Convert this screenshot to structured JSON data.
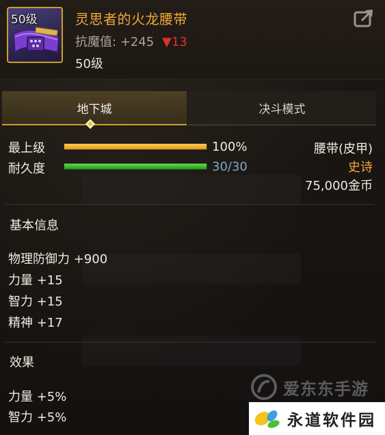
{
  "item": {
    "level_badge": "50级",
    "name": "灵思者的火龙腰带",
    "stat_label": "抗魔值:",
    "stat_value": "+245",
    "stat_change": "▼13",
    "required_level": "50级"
  },
  "tabs": [
    {
      "label": "地下城",
      "active": true
    },
    {
      "label": "决斗模式",
      "active": false
    }
  ],
  "bars": [
    {
      "label": "最上级",
      "value_text": "100%",
      "fill": 1.0,
      "color": "#f0a020"
    },
    {
      "label": "耐久度",
      "value_text": "30/30",
      "fill": 1.0,
      "color": "#3cc030"
    }
  ],
  "info": {
    "type": "腰带(皮甲)",
    "rarity": "史诗",
    "price": "75,000金币"
  },
  "basic_info": {
    "title": "基本信息",
    "attrs": [
      "物理防御力 +900",
      "力量 +15",
      "智力 +15",
      "精神 +17"
    ]
  },
  "effects": {
    "title": "效果",
    "attrs": [
      "力量 +5%",
      "智力 +5%"
    ]
  },
  "colors": {
    "item_name": "#f3a73a",
    "rarity": "#f3a73a",
    "stat_down": "#e0312b",
    "durability_text": "#7fa6c9",
    "tab_accent": "#c9a227"
  },
  "icons": {
    "share": "share-export-icon",
    "belt": "belt-icon"
  },
  "watermarks": [
    "爱东东手游",
    "永道软件园"
  ]
}
